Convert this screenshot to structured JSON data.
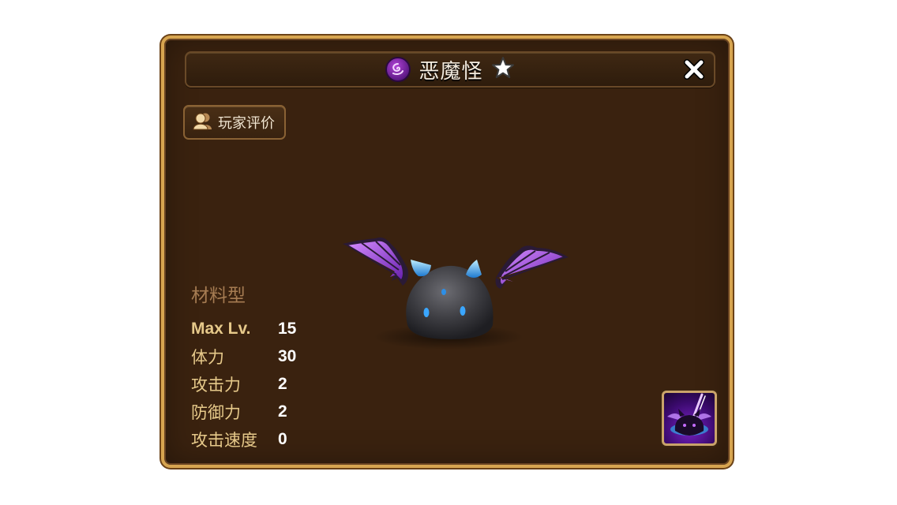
{
  "header": {
    "element_icon": "dark-element-icon",
    "monster_name": "恶魔怪",
    "star_icon": "star-icon",
    "close_icon": "close-icon"
  },
  "review_button": {
    "icon": "players-icon",
    "label": "玩家评价"
  },
  "monster": {
    "image": "demon-bat-monster-image"
  },
  "stats": {
    "type_label": "材料型",
    "rows": [
      {
        "label": "Max Lv.",
        "value": "15"
      },
      {
        "label": "体力",
        "value": "30"
      },
      {
        "label": "攻击力",
        "value": "2"
      },
      {
        "label": "防御力",
        "value": "2"
      },
      {
        "label": "攻击速度",
        "value": "0"
      }
    ]
  },
  "skill": {
    "icon": "dark-skill-icon"
  },
  "colors": {
    "panel_bg": "#3a220f",
    "border_gold": "#d7a550",
    "stat_label": "#e6c98a",
    "type_label": "#a67c52",
    "element_purple": "#9b2fc4"
  }
}
